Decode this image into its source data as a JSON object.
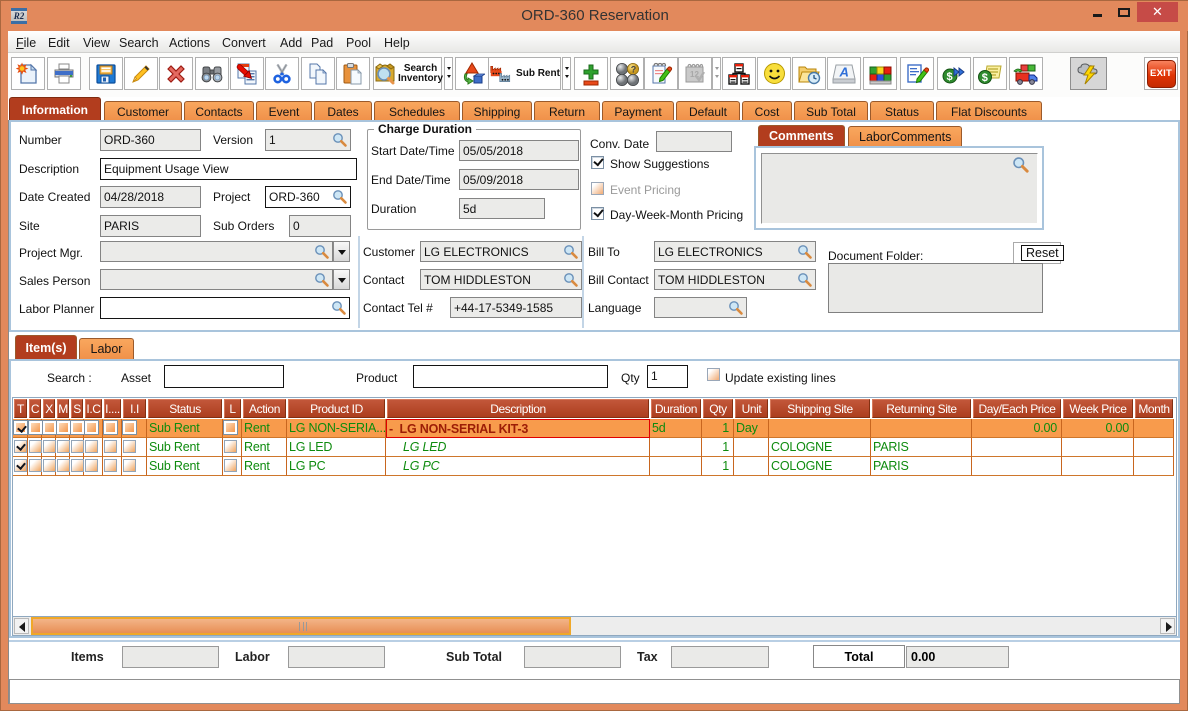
{
  "window": {
    "title": "ORD-360 Reservation",
    "app_icon_text": "R2"
  },
  "menu": {
    "items": [
      {
        "label": "File"
      },
      {
        "label": "Edit"
      },
      {
        "label": "View"
      },
      {
        "label": "Search"
      },
      {
        "label": "Actions"
      },
      {
        "label": "Convert"
      },
      {
        "label": "Add"
      },
      {
        "label": "Pad"
      },
      {
        "label": "Pool"
      },
      {
        "label": "Help"
      }
    ]
  },
  "toolbar": {
    "search_inventory_label_1": "Search",
    "search_inventory_label_2": "Inventory",
    "sub_rent_label": "Sub Rent",
    "exit_label": "EXIT"
  },
  "tabs": [
    {
      "label": "Information",
      "active": true
    },
    {
      "label": "Customer"
    },
    {
      "label": "Contacts"
    },
    {
      "label": "Event"
    },
    {
      "label": "Dates"
    },
    {
      "label": "Schedules"
    },
    {
      "label": "Shipping"
    },
    {
      "label": "Return"
    },
    {
      "label": "Payment"
    },
    {
      "label": "Default"
    },
    {
      "label": "Cost"
    },
    {
      "label": "Sub Total"
    },
    {
      "label": "Status"
    },
    {
      "label": "Flat Discounts"
    }
  ],
  "form": {
    "number_label": "Number",
    "number_value": "ORD-360",
    "version_label": "Version",
    "version_value": "1",
    "description_label": "Description",
    "description_value": "Equipment Usage View",
    "date_created_label": "Date Created",
    "date_created_value": "04/28/2018",
    "project_label": "Project",
    "project_value": "ORD-360",
    "site_label": "Site",
    "site_value": "PARIS",
    "sub_orders_label": "Sub Orders",
    "sub_orders_value": "0",
    "project_mgr_label": "Project Mgr.",
    "project_mgr_value": "",
    "sales_person_label": "Sales Person",
    "sales_person_value": "",
    "labor_planner_label": "Labor Planner",
    "labor_planner_value": "",
    "charge_duration_title": "Charge Duration",
    "start_label": "Start Date/Time",
    "start_value": "05/05/2018",
    "end_label": "End Date/Time",
    "end_value": "05/09/2018",
    "duration_label": "Duration",
    "duration_value": "5d",
    "conv_date_label": "Conv. Date",
    "conv_date_value": "",
    "show_suggestions_label": "Show Suggestions",
    "event_pricing_label": "Event Pricing",
    "dwm_pricing_label": "Day-Week-Month Pricing",
    "customer_label": "Customer",
    "customer_value": "LG ELECTRONICS",
    "bill_to_label": "Bill To",
    "bill_to_value": "LG ELECTRONICS",
    "contact_label": "Contact",
    "contact_value": "TOM HIDDLESTON",
    "bill_contact_label": "Bill Contact",
    "bill_contact_value": "TOM HIDDLESTON",
    "contact_tel_label": "Contact Tel #",
    "contact_tel_value": "+44-17-5349-1585",
    "language_label": "Language",
    "language_value": "",
    "comments_tab": "Comments",
    "labor_comments_tab": "LaborComments",
    "comments_value": "",
    "document_folder_label": "Document Folder:",
    "reset_label": "Reset",
    "document_folder_value": ""
  },
  "item_tabs": [
    {
      "label": "Item(s)",
      "active": true
    },
    {
      "label": "Labor"
    }
  ],
  "search_bar": {
    "search_label": "Search :",
    "asset_label": "Asset",
    "asset_value": "",
    "product_label": "Product",
    "product_value": "",
    "qty_label": "Qty",
    "qty_value": "1",
    "update_label": "Update existing lines"
  },
  "grid": {
    "columns": [
      {
        "label": "T"
      },
      {
        "label": "C"
      },
      {
        "label": "X"
      },
      {
        "label": "M"
      },
      {
        "label": "S"
      },
      {
        "label": "I.C"
      },
      {
        "label": "I...."
      },
      {
        "label": "I.I"
      },
      {
        "label": "Status"
      },
      {
        "label": "L"
      },
      {
        "label": "Action"
      },
      {
        "label": "Product ID"
      },
      {
        "label": "Description"
      },
      {
        "label": "Duration"
      },
      {
        "label": "Qty"
      },
      {
        "label": "Unit"
      },
      {
        "label": "Shipping Site"
      },
      {
        "label": "Returning Site"
      },
      {
        "label": "Day/Each Price"
      },
      {
        "label": "Week Price"
      },
      {
        "label": "Month"
      }
    ],
    "rows": [
      {
        "t": true,
        "status": "Sub Rent",
        "action": "Rent",
        "product_id": "LG NON-SERIA...",
        "description": "-  LG NON-SERIAL KIT-3",
        "duration": "5d",
        "qty": "1",
        "unit": "Day",
        "shipping_site": "",
        "returning_site": "",
        "day_price": "0.00",
        "week_price": "0.00",
        "month_price": ""
      },
      {
        "t": true,
        "status": "Sub Rent",
        "action": "Rent",
        "product_id": "LG LED",
        "description": "LG LED",
        "duration": "",
        "qty": "1",
        "unit": "",
        "shipping_site": "COLOGNE",
        "returning_site": "PARIS",
        "day_price": "",
        "week_price": "",
        "month_price": ""
      },
      {
        "t": true,
        "status": "Sub Rent",
        "action": "Rent",
        "product_id": "LG PC",
        "description": "LG PC",
        "duration": "",
        "qty": "1",
        "unit": "",
        "shipping_site": "COLOGNE",
        "returning_site": "PARIS",
        "day_price": "",
        "week_price": "",
        "month_price": ""
      }
    ]
  },
  "totals": {
    "items_label": "Items",
    "items_value": "",
    "labor_label": "Labor",
    "labor_value": "",
    "sub_total_label": "Sub Total",
    "sub_total_value": "",
    "tax_label": "Tax",
    "tax_value": "",
    "total_label": "Total",
    "total_value": "0.00"
  },
  "status_bar": {
    "text": ""
  }
}
